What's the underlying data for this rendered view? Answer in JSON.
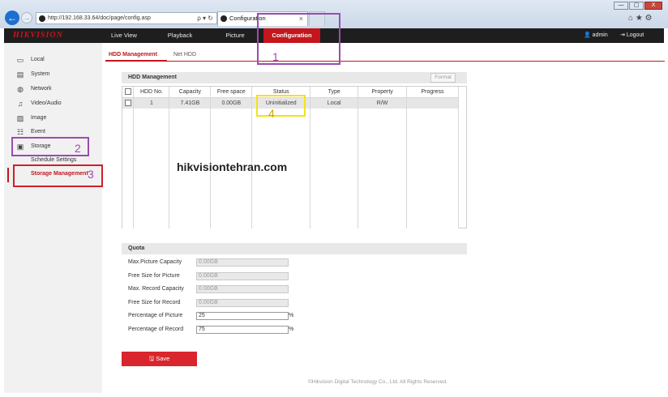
{
  "browser": {
    "address": "http://192.168.33.64/doc/page/config.asp",
    "address_tools": "ρ ▾ ↻",
    "tab_title": "Configuration",
    "tab_close": "×",
    "window_controls": [
      "—",
      "▢",
      "X"
    ],
    "toolbar_icons": "⌂ ★ ⚙"
  },
  "app": {
    "logo": "HIKVISION",
    "nav": [
      "Live View",
      "Playback",
      "Picture",
      "Configuration"
    ],
    "user": "admin",
    "logout": "Logout"
  },
  "sidebar": {
    "items": [
      {
        "label": "Local",
        "icon": "monitor-icon"
      },
      {
        "label": "System",
        "icon": "system-icon"
      },
      {
        "label": "Network",
        "icon": "globe-icon"
      },
      {
        "label": "Video/Audio",
        "icon": "video-audio-icon"
      },
      {
        "label": "Image",
        "icon": "image-icon"
      },
      {
        "label": "Event",
        "icon": "event-icon"
      },
      {
        "label": "Storage",
        "icon": "storage-icon"
      }
    ],
    "sub_items": [
      "Schedule Settings",
      "Storage Management"
    ]
  },
  "main": {
    "tabs": [
      "HDD Management",
      "Net HDD"
    ],
    "hdd_panel_title": "HDD Management",
    "format_button": "Format",
    "table": {
      "headers": [
        "HDD No.",
        "Capacity",
        "Free space",
        "Status",
        "Type",
        "Property",
        "Progress"
      ],
      "rows": [
        [
          "1",
          "7.41GB",
          "0.00GB",
          "Uninitialized",
          "Local",
          "R/W",
          ""
        ]
      ]
    },
    "quota": {
      "title": "Quota",
      "fields": [
        {
          "label": "Max.Picture Capacity",
          "value": "0.00GB"
        },
        {
          "label": "Free Size for Picture",
          "value": "0.00GB"
        },
        {
          "label": "Max. Record Capacity",
          "value": "0.00GB"
        },
        {
          "label": "Free Size for Record",
          "value": "0.00GB"
        },
        {
          "label": "Percentage of Picture",
          "value": "25",
          "unit": "%"
        },
        {
          "label": "Percentage of Record",
          "value": "75",
          "unit": "%"
        }
      ]
    },
    "save_button": "Save",
    "copyright": "©Hikvision Digital Technology Co., Ltd. All Rights Reserved."
  },
  "overlay": {
    "watermark": "hikvisiontehran.com",
    "step_numbers": [
      "1",
      "2",
      "3",
      "4"
    ],
    "colors": {
      "purple": "#9b4bb0",
      "red": "#d0202a",
      "yellow": "#f3e21c"
    }
  },
  "colors": {
    "brand_red": "#c4161c",
    "header_bg": "#1e1e1e"
  }
}
